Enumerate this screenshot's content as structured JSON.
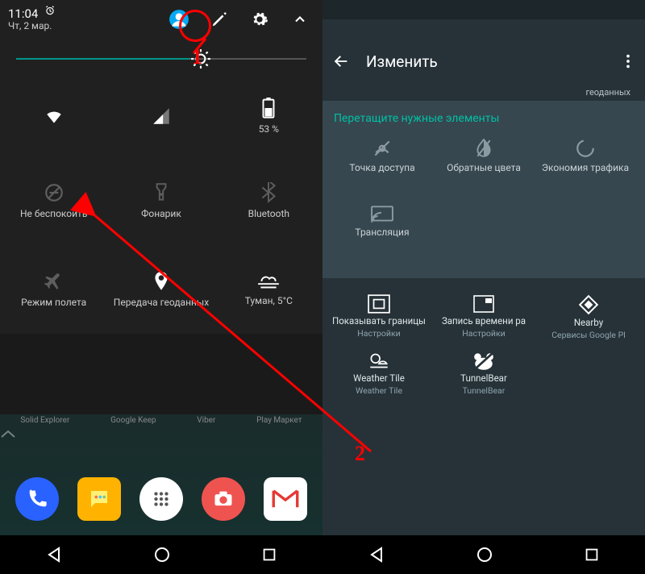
{
  "left": {
    "status": {
      "time": "11:04",
      "date": "Чт, 2 мар."
    },
    "battery_label": "53 %",
    "tiles": {
      "wifi": "",
      "cell": "",
      "battery": "53 %",
      "dnd": "Не беспокоить",
      "flashlight": "Фонарик",
      "bluetooth": "Bluetooth",
      "airplane": "Режим полета",
      "location": "Передача геоданных",
      "weather": "Туман, 5°C"
    },
    "home_labels": {
      "a1": "Solid Explorer",
      "a2": "Google Keep",
      "a3": "Viber",
      "a4": "Play Маркет"
    }
  },
  "right": {
    "header": {
      "title": "Изменить"
    },
    "geo_remnant": "геоданных",
    "drag_hint": "Перетащите нужные элементы",
    "drag_tiles": {
      "hotspot": "Точка доступа",
      "invert": "Обратные цвета",
      "datasaver": "Экономия трафика",
      "cast": "Трансляция"
    },
    "sys_tiles": {
      "t1": {
        "label": "Показывать границы",
        "sub": "Настройки"
      },
      "t2": {
        "label": "Запись времени ра",
        "sub": "Настройки"
      },
      "t3": {
        "label": "Nearby",
        "sub": "Сервисы Google Pl"
      },
      "t4": {
        "label": "Weather Tile",
        "sub": "Weather Tile"
      },
      "t5": {
        "label": "TunnelBear",
        "sub": "TunnelBear"
      }
    }
  },
  "annotations": {
    "n1": "1",
    "n2": "2"
  }
}
